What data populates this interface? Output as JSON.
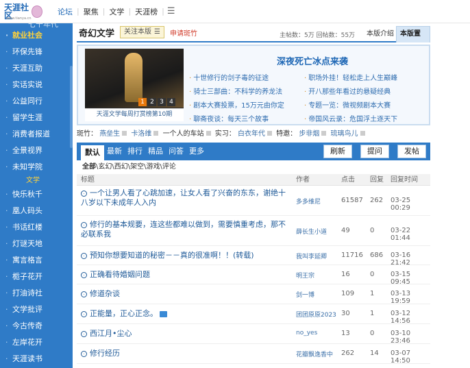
{
  "topbar": {
    "logo_text": "天涯社区",
    "logo_url": "www.tianya.cn",
    "nav": [
      "论坛",
      "聚焦",
      "文学",
      "天涯榜"
    ]
  },
  "sidebar": {
    "partial_top": "七十年代",
    "items_a": [
      "就业社会",
      "环保先锋",
      "天涯互助",
      "实话实说",
      "公益同行",
      "留学生涯",
      "消费者报道",
      "全景视界",
      "未知学院"
    ],
    "section": "文学",
    "items_b": [
      "快乐秋千",
      "凰人码头",
      "书话红楼",
      "灯谜天地",
      "寓言格言",
      "栀子花开",
      "打油诗社",
      "文学批评",
      "今古传奇",
      "左岸花开",
      "天涯读书"
    ]
  },
  "forum": {
    "title": "奇幻文学",
    "follow_label": "关注本版",
    "apply_label": "申请斑竹",
    "counts": "主帖数：5万 回帖数：55万",
    "intro_tab": "本版介绍",
    "pin_tab": "本版置顶"
  },
  "feature": {
    "headline": "深夜死亡冰点来袭",
    "caption": "天涯文学每周打赏榜第10期",
    "pager": [
      "1",
      "2",
      "3",
      "4"
    ],
    "links_a": [
      "十世修行的剑子毒的征途",
      "骑士三部曲：不科学的养龙法",
      "剧本大赛投票，15万元由你定",
      "聊斋夜谈：每天三个故事"
    ],
    "links_b": [
      "职场外挂！轻松走上人生巅峰",
      "开八那些年看过的悬疑经典",
      "专题一览：微视频剧本大赛",
      "帝国风云录：危国浮土逐天下"
    ]
  },
  "moderators": {
    "label1": "斑竹：",
    "mods": [
      "燕垒生",
      "卡洛维"
    ],
    "mod3": "一个人的车站",
    "label2": "实习：",
    "intern": "白衣年代",
    "label3": "特邀：",
    "invited": [
      "步非烟",
      "琉璃鸟儿"
    ]
  },
  "tabs": {
    "items": [
      "默认",
      "最新",
      "排行",
      "精品",
      "问答",
      "更多"
    ],
    "refresh": "刷新",
    "ask": "提问",
    "post": "发帖"
  },
  "crumbs": {
    "all": "全部",
    "rest": "\\玄幻\\西幻\\架空\\游戏\\评论"
  },
  "table": {
    "headers": [
      "标题",
      "作者",
      "点击",
      "回复",
      "回复时间"
    ],
    "rows": [
      {
        "title": "一个让男人看了心跳加速，让女人看了兴奋的东东，谢绝十八岁以下未成年人入内",
        "author": "多多维尼",
        "clicks": "61587",
        "replies": "262",
        "time": "03-25 00:29"
      },
      {
        "title": "修行的基本规要，连这些都难以做到，需要慎重考虑，那不必联系我",
        "author": "薛长生小道",
        "clicks": "49",
        "replies": "0",
        "time": "03-22 01:44"
      },
      {
        "title": "预知你想要知道的秘密－－真的很准啊！！(转载)",
        "author": "我叫李延卿",
        "clicks": "11716",
        "replies": "686",
        "time": "03-16 21:42"
      },
      {
        "title": "正确看待婚姻问题",
        "author": "明王宗",
        "clicks": "16",
        "replies": "0",
        "time": "03-15 09:45"
      },
      {
        "title": "修道杂谈",
        "author": "剑一博",
        "clicks": "109",
        "replies": "1",
        "time": "03-13 19:59"
      },
      {
        "title": "正能量，正心正念。",
        "author": "团团原原2023",
        "clicks": "30",
        "replies": "1",
        "time": "03-12 14:56"
      },
      {
        "title": "西江月•尘心",
        "author": "no_yes",
        "clicks": "13",
        "replies": "0",
        "time": "03-10 23:46"
      },
      {
        "title": "修行经历",
        "author": "花瓣飘逸香中",
        "clicks": "262",
        "replies": "14",
        "time": "03-07 14:50"
      }
    ]
  }
}
